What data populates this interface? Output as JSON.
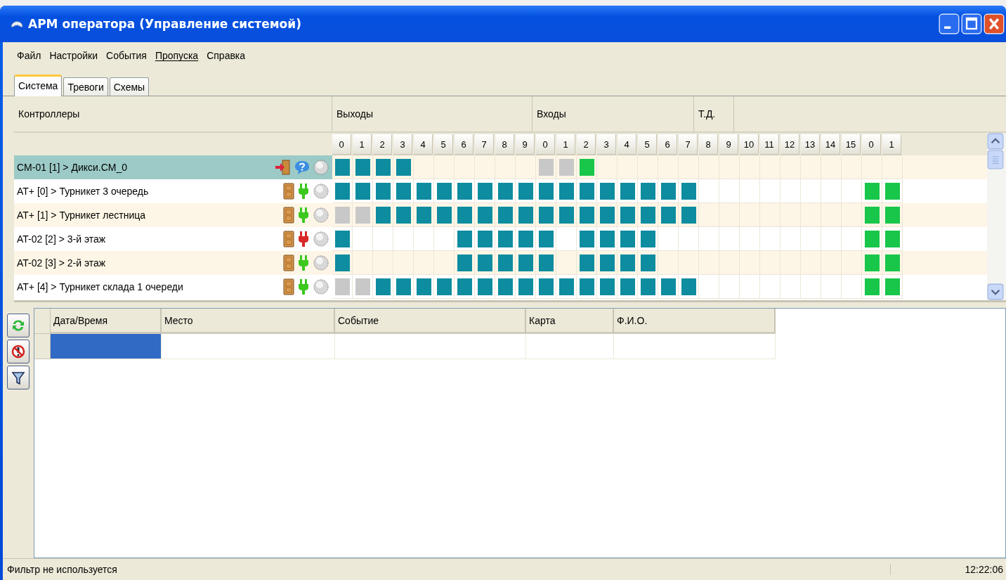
{
  "window": {
    "title": "АРМ оператора  (Управление системой)"
  },
  "menu": [
    {
      "label": "Файл",
      "accelerator": false
    },
    {
      "label": "Настройки",
      "accelerator": false
    },
    {
      "label": "События",
      "accelerator": false
    },
    {
      "label": "Пропуска",
      "accelerator": true
    },
    {
      "label": "Справка",
      "accelerator": false
    }
  ],
  "tabs": [
    {
      "label": "Система",
      "selected": true
    },
    {
      "label": "Тревоги",
      "selected": false
    },
    {
      "label": "Схемы",
      "selected": false
    }
  ],
  "grid": {
    "group_headers": [
      {
        "label": "Контроллеры",
        "kind": "name"
      },
      {
        "label": "Выходы",
        "kind": "outputs"
      },
      {
        "label": "Входы",
        "kind": "inputs"
      },
      {
        "label": "Т.Д.",
        "kind": "td"
      }
    ],
    "columns": [
      "0",
      "1",
      "2",
      "3",
      "4",
      "5",
      "6",
      "7",
      "8",
      "9",
      "0",
      "1",
      "2",
      "3",
      "4",
      "5",
      "6",
      "7",
      "8",
      "9",
      "10",
      "11",
      "12",
      "13",
      "14",
      "15",
      "0",
      "1"
    ],
    "rows": [
      {
        "name": "CM-01 [1] > Дикси.CM_0",
        "selected": true,
        "door_alarm": true,
        "status_known": false,
        "cells": [
          {
            "on": true,
            "color": "#0e8ca0"
          },
          {
            "on": true,
            "color": "#0e8ca0"
          },
          {
            "on": true,
            "color": "#0e8ca0"
          },
          {
            "on": true,
            "color": "#0e8ca0"
          },
          {
            "on": false
          },
          {
            "on": false
          },
          {
            "on": false
          },
          {
            "on": false
          },
          {
            "on": false
          },
          {
            "on": false
          },
          {
            "on": true,
            "color": "#c8c8c8"
          },
          {
            "on": true,
            "color": "#c8c8c8"
          },
          {
            "on": true,
            "color": "#18c64a"
          },
          {
            "on": false
          },
          {
            "on": false
          },
          {
            "on": false
          },
          {
            "on": false
          },
          {
            "on": false
          },
          {
            "on": false
          },
          {
            "on": false
          },
          {
            "on": false
          },
          {
            "on": false
          },
          {
            "on": false
          },
          {
            "on": false
          },
          {
            "on": false
          },
          {
            "on": false
          },
          {
            "on": false
          },
          {
            "on": false
          }
        ]
      },
      {
        "name": "AT+ [0] > Турникет 3 очередь",
        "selected": false,
        "door_alarm": false,
        "status_known": true,
        "connected": true,
        "cells": [
          {
            "on": true,
            "color": "#0e8ca0"
          },
          {
            "on": true,
            "color": "#0e8ca0"
          },
          {
            "on": true,
            "color": "#0e8ca0"
          },
          {
            "on": true,
            "color": "#0e8ca0"
          },
          {
            "on": true,
            "color": "#0e8ca0"
          },
          {
            "on": true,
            "color": "#0e8ca0"
          },
          {
            "on": true,
            "color": "#0e8ca0"
          },
          {
            "on": true,
            "color": "#0e8ca0"
          },
          {
            "on": true,
            "color": "#0e8ca0"
          },
          {
            "on": true,
            "color": "#0e8ca0"
          },
          {
            "on": true,
            "color": "#0e8ca0"
          },
          {
            "on": true,
            "color": "#0e8ca0"
          },
          {
            "on": true,
            "color": "#0e8ca0"
          },
          {
            "on": true,
            "color": "#0e8ca0"
          },
          {
            "on": true,
            "color": "#0e8ca0"
          },
          {
            "on": true,
            "color": "#0e8ca0"
          },
          {
            "on": true,
            "color": "#0e8ca0"
          },
          {
            "on": true,
            "color": "#0e8ca0"
          },
          {
            "on": false
          },
          {
            "on": false
          },
          {
            "on": false
          },
          {
            "on": false
          },
          {
            "on": false
          },
          {
            "on": false
          },
          {
            "on": false
          },
          {
            "on": false
          },
          {
            "on": true,
            "color": "#18c64a"
          },
          {
            "on": true,
            "color": "#18c64a"
          }
        ]
      },
      {
        "name": "AT+ [1] > Турникет лестница",
        "selected": false,
        "door_alarm": false,
        "status_known": true,
        "connected": true,
        "cells": [
          {
            "on": true,
            "color": "#c8c8c8"
          },
          {
            "on": true,
            "color": "#c8c8c8"
          },
          {
            "on": true,
            "color": "#0e8ca0"
          },
          {
            "on": true,
            "color": "#0e8ca0"
          },
          {
            "on": true,
            "color": "#0e8ca0"
          },
          {
            "on": true,
            "color": "#0e8ca0"
          },
          {
            "on": true,
            "color": "#0e8ca0"
          },
          {
            "on": true,
            "color": "#0e8ca0"
          },
          {
            "on": true,
            "color": "#0e8ca0"
          },
          {
            "on": true,
            "color": "#0e8ca0"
          },
          {
            "on": true,
            "color": "#0e8ca0"
          },
          {
            "on": true,
            "color": "#0e8ca0"
          },
          {
            "on": true,
            "color": "#0e8ca0"
          },
          {
            "on": true,
            "color": "#0e8ca0"
          },
          {
            "on": true,
            "color": "#0e8ca0"
          },
          {
            "on": true,
            "color": "#0e8ca0"
          },
          {
            "on": true,
            "color": "#0e8ca0"
          },
          {
            "on": true,
            "color": "#0e8ca0"
          },
          {
            "on": false
          },
          {
            "on": false
          },
          {
            "on": false
          },
          {
            "on": false
          },
          {
            "on": false
          },
          {
            "on": false
          },
          {
            "on": false
          },
          {
            "on": false
          },
          {
            "on": true,
            "color": "#18c64a"
          },
          {
            "on": true,
            "color": "#18c64a"
          }
        ]
      },
      {
        "name": "AT-02 [2] > 3-й этаж",
        "selected": false,
        "door_alarm": false,
        "status_known": true,
        "connected": false,
        "cells": [
          {
            "on": true,
            "color": "#0e8ca0"
          },
          {
            "on": false
          },
          {
            "on": false
          },
          {
            "on": false
          },
          {
            "on": false
          },
          {
            "on": false
          },
          {
            "on": true,
            "color": "#0e8ca0"
          },
          {
            "on": true,
            "color": "#0e8ca0"
          },
          {
            "on": true,
            "color": "#0e8ca0"
          },
          {
            "on": true,
            "color": "#0e8ca0"
          },
          {
            "on": true,
            "color": "#0e8ca0"
          },
          {
            "on": false
          },
          {
            "on": true,
            "color": "#0e8ca0"
          },
          {
            "on": true,
            "color": "#0e8ca0"
          },
          {
            "on": true,
            "color": "#0e8ca0"
          },
          {
            "on": true,
            "color": "#0e8ca0"
          },
          {
            "on": false
          },
          {
            "on": false
          },
          {
            "on": false
          },
          {
            "on": false
          },
          {
            "on": false
          },
          {
            "on": false
          },
          {
            "on": false
          },
          {
            "on": false
          },
          {
            "on": false
          },
          {
            "on": false
          },
          {
            "on": true,
            "color": "#18c64a"
          },
          {
            "on": true,
            "color": "#18c64a"
          }
        ]
      },
      {
        "name": "AT-02 [3] > 2-й этаж",
        "selected": false,
        "door_alarm": false,
        "status_known": true,
        "connected": true,
        "cells": [
          {
            "on": true,
            "color": "#0e8ca0"
          },
          {
            "on": false
          },
          {
            "on": false
          },
          {
            "on": false
          },
          {
            "on": false
          },
          {
            "on": false
          },
          {
            "on": true,
            "color": "#0e8ca0"
          },
          {
            "on": true,
            "color": "#0e8ca0"
          },
          {
            "on": true,
            "color": "#0e8ca0"
          },
          {
            "on": true,
            "color": "#0e8ca0"
          },
          {
            "on": true,
            "color": "#0e8ca0"
          },
          {
            "on": false
          },
          {
            "on": true,
            "color": "#0e8ca0"
          },
          {
            "on": true,
            "color": "#0e8ca0"
          },
          {
            "on": true,
            "color": "#0e8ca0"
          },
          {
            "on": true,
            "color": "#0e8ca0"
          },
          {
            "on": false
          },
          {
            "on": false
          },
          {
            "on": false
          },
          {
            "on": false
          },
          {
            "on": false
          },
          {
            "on": false
          },
          {
            "on": false
          },
          {
            "on": false
          },
          {
            "on": false
          },
          {
            "on": false
          },
          {
            "on": true,
            "color": "#18c64a"
          },
          {
            "on": true,
            "color": "#18c64a"
          }
        ]
      },
      {
        "name": "AT+ [4] > Турникет склада 1 очереди",
        "selected": false,
        "door_alarm": false,
        "status_known": true,
        "connected": true,
        "cells": [
          {
            "on": true,
            "color": "#c8c8c8"
          },
          {
            "on": true,
            "color": "#c8c8c8"
          },
          {
            "on": true,
            "color": "#0e8ca0"
          },
          {
            "on": true,
            "color": "#0e8ca0"
          },
          {
            "on": true,
            "color": "#0e8ca0"
          },
          {
            "on": true,
            "color": "#0e8ca0"
          },
          {
            "on": true,
            "color": "#0e8ca0"
          },
          {
            "on": true,
            "color": "#0e8ca0"
          },
          {
            "on": true,
            "color": "#0e8ca0"
          },
          {
            "on": true,
            "color": "#0e8ca0"
          },
          {
            "on": true,
            "color": "#0e8ca0"
          },
          {
            "on": true,
            "color": "#0e8ca0"
          },
          {
            "on": true,
            "color": "#0e8ca0"
          },
          {
            "on": true,
            "color": "#0e8ca0"
          },
          {
            "on": true,
            "color": "#0e8ca0"
          },
          {
            "on": true,
            "color": "#0e8ca0"
          },
          {
            "on": true,
            "color": "#0e8ca0"
          },
          {
            "on": true,
            "color": "#0e8ca0"
          },
          {
            "on": false
          },
          {
            "on": false
          },
          {
            "on": false
          },
          {
            "on": false
          },
          {
            "on": false
          },
          {
            "on": false
          },
          {
            "on": false
          },
          {
            "on": false
          },
          {
            "on": true,
            "color": "#18c64a"
          },
          {
            "on": true,
            "color": "#18c64a"
          }
        ]
      }
    ]
  },
  "events_table": {
    "columns": [
      {
        "label": "Дата/Время",
        "current": true
      },
      {
        "label": "Место",
        "current": false
      },
      {
        "label": "Событие",
        "current": false
      },
      {
        "label": "Карта",
        "current": false
      },
      {
        "label": "Ф.И.О.",
        "current": false
      }
    ]
  },
  "status_bar": {
    "text": "Фильтр не используется",
    "time": "12:22:06"
  }
}
